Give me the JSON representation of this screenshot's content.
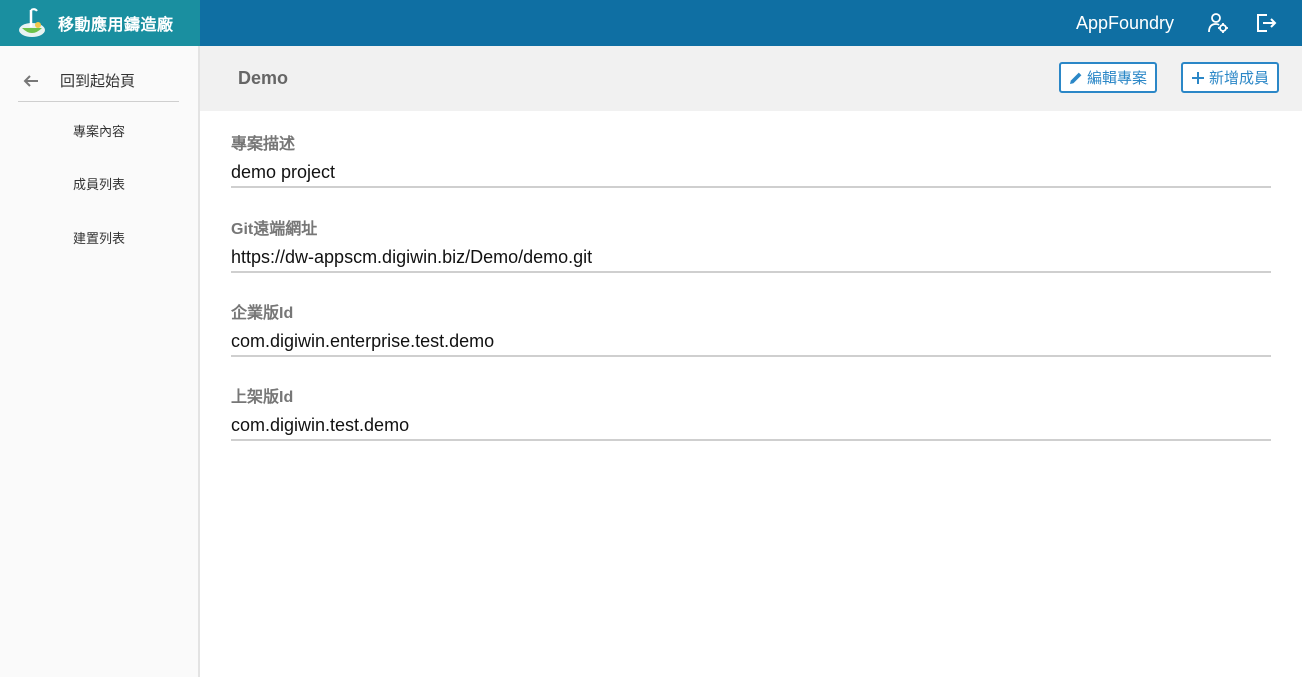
{
  "topbar": {
    "brand_title": "移動應用鑄造廠",
    "app_name": "AppFoundry",
    "accent": "#0f6fa3",
    "brand_bg": "#1a8fa0",
    "icons": [
      "logo-icon",
      "user-settings-icon",
      "logout-icon"
    ]
  },
  "sidebar": {
    "back_label": "回到起始頁",
    "items": [
      {
        "label": "專案內容"
      },
      {
        "label": "成員列表"
      },
      {
        "label": "建置列表"
      }
    ]
  },
  "header": {
    "title": "Demo",
    "edit_label": "編輯專案",
    "add_label": "新增成員",
    "button_color": "#2b87c7"
  },
  "fields": [
    {
      "label": "專案描述",
      "value": "demo project"
    },
    {
      "label": "Git遠端網址",
      "value": "https://dw-appscm.digiwin.biz/Demo/demo.git"
    },
    {
      "label": "企業版Id",
      "value": "com.digiwin.enterprise.test.demo"
    },
    {
      "label": "上架版Id",
      "value": "com.digiwin.test.demo"
    }
  ]
}
